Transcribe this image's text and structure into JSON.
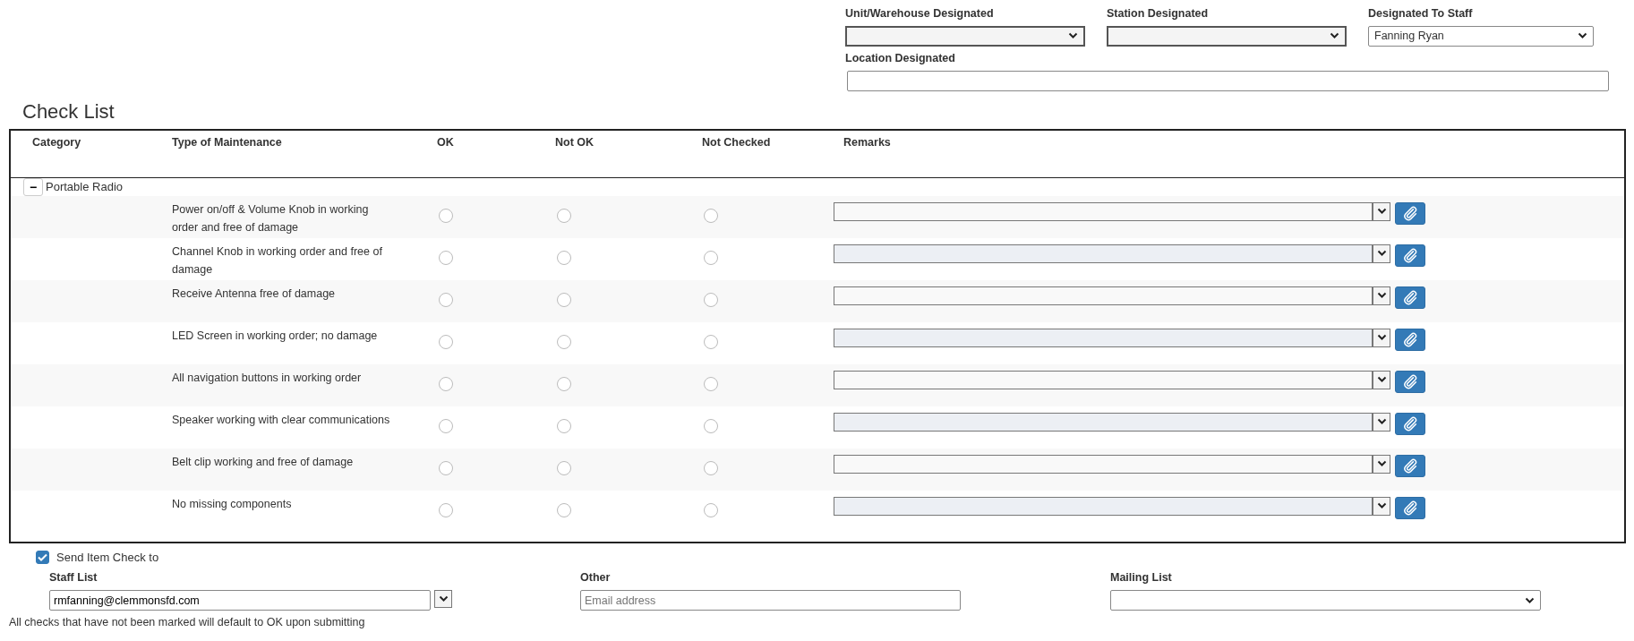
{
  "designation": {
    "fields": [
      {
        "label": "Unit/Warehouse Designated",
        "disabled": true
      },
      {
        "label": "Station Designated",
        "disabled": true
      },
      {
        "label": "Designated To Staff",
        "value": "Fanning Ryan",
        "disabled": false
      }
    ],
    "location": {
      "label": "Location Designated"
    }
  },
  "checklist": {
    "title": "Check List",
    "columns": [
      "Category",
      "Type of Maintenance",
      "OK",
      "Not OK",
      "Not Checked",
      "Remarks"
    ],
    "groups": [
      {
        "name": "Portable Radio",
        "expanded": true,
        "toggle": "−",
        "items": [
          {
            "task": "Power on/off & Volume Knob in working order and free of damage",
            "ok": false,
            "not_ok": false,
            "not_checked": false
          },
          {
            "task": "Channel Knob in working order and free of damage",
            "ok": false,
            "not_ok": false,
            "not_checked": false
          },
          {
            "task": "Receive Antenna free of damage",
            "ok": false,
            "not_ok": false,
            "not_checked": false
          },
          {
            "task": "LED Screen in working order; no damage",
            "ok": false,
            "not_ok": false,
            "not_checked": false
          },
          {
            "task": "All navigation buttons in working order",
            "ok": false,
            "not_ok": false,
            "not_checked": false
          },
          {
            "task": "Speaker working with clear communications",
            "ok": false,
            "not_ok": false,
            "not_checked": false
          },
          {
            "task": "Belt clip working and free of damage",
            "ok": false,
            "not_ok": false,
            "not_checked": false
          },
          {
            "task": "No missing components",
            "ok": false,
            "not_ok": false,
            "not_checked": false
          }
        ]
      }
    ]
  },
  "send": {
    "label": "Send Item Check to",
    "checked": true,
    "staff_list": {
      "label": "Staff List",
      "value": "rmfanning@clemmonsfd.com"
    },
    "other": {
      "label": "Other",
      "placeholder": "Email address"
    },
    "mailing_list": {
      "label": "Mailing List"
    }
  },
  "footer_note": "All checks that have not been marked will default to OK upon submitting"
}
